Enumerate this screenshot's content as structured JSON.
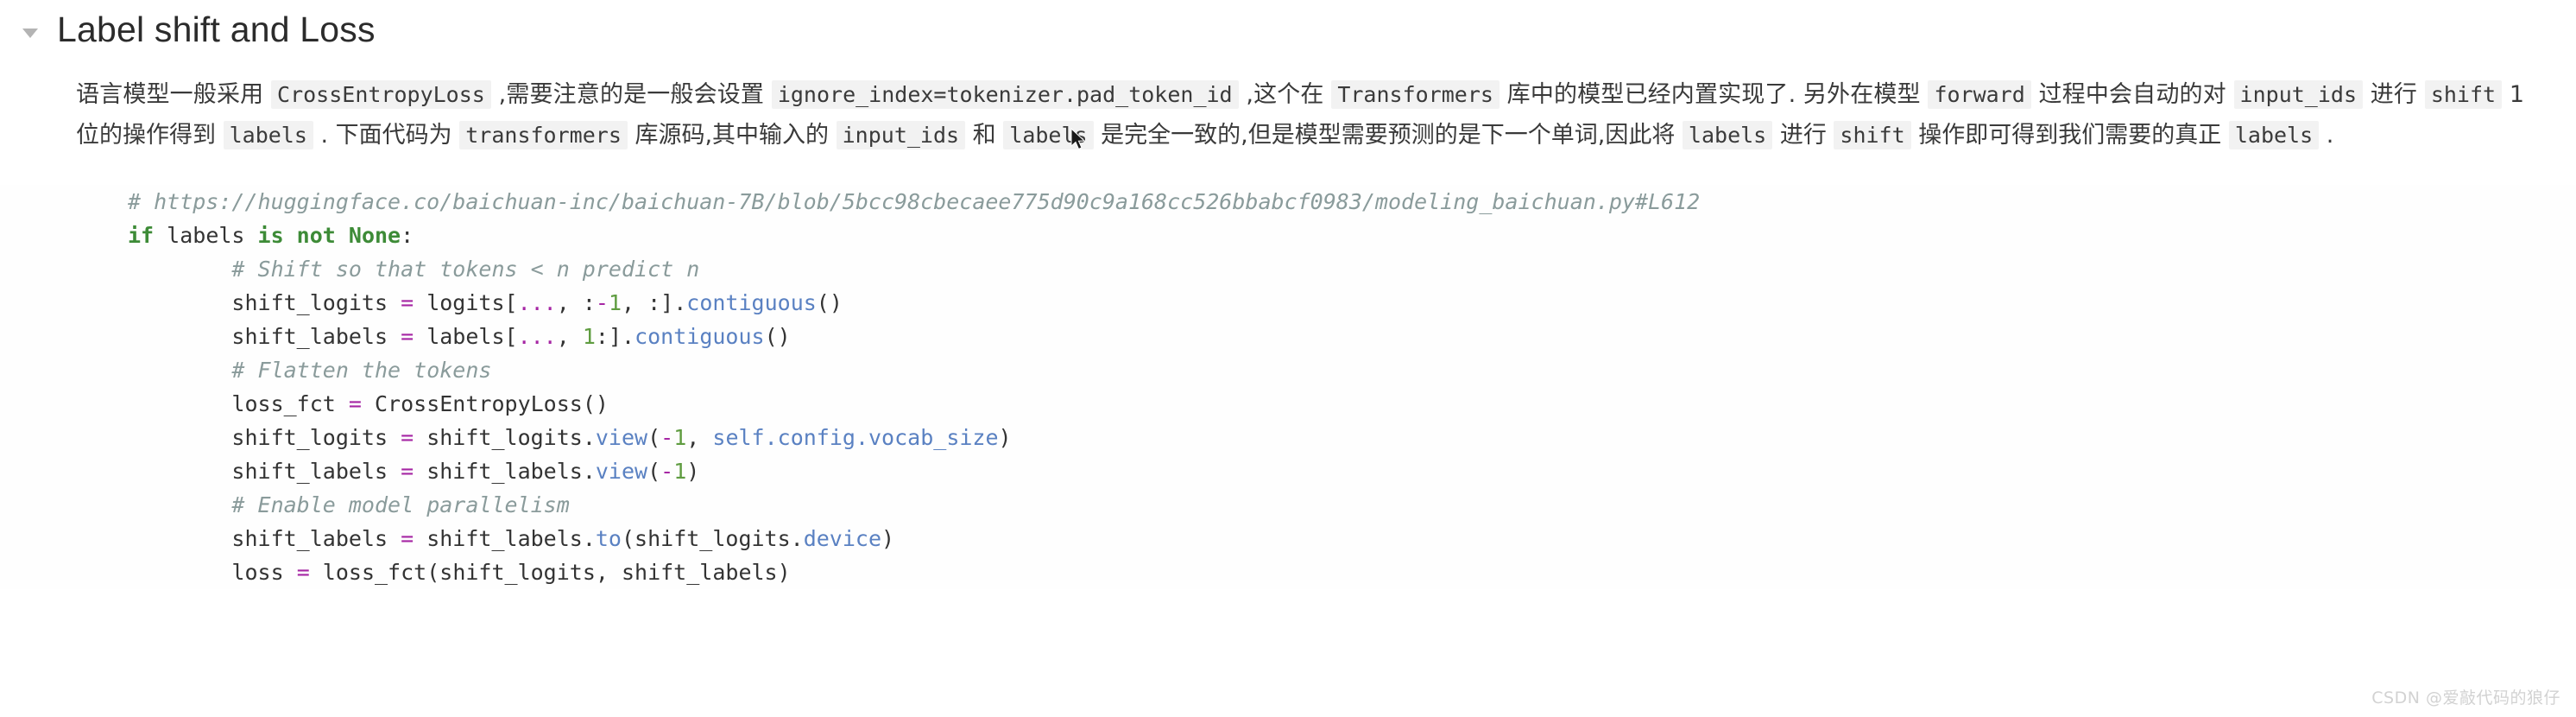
{
  "heading": {
    "toggle_icon": "chevron-down-triangle-icon",
    "title": "Label shift and Loss"
  },
  "paragraph": {
    "seg1": "语言模型一般采用 ",
    "code1": "CrossEntropyLoss",
    "seg2": " ,需要注意的是一般会设置 ",
    "code2": "ignore_index=tokenizer.pad_token_id",
    "seg3": " ,这个在 ",
    "code3": "Transformers",
    "seg4": " 库中的模型已经内置实现了. 另外在模型 ",
    "code4": "forward",
    "seg5": " 过程中会自动的对 ",
    "code5": "input_ids",
    "seg6": " 进行 ",
    "code6": "shift",
    "seg7": " 1位的操作得到 ",
    "code7": "labels",
    "seg8": " . 下面代码为 ",
    "code8": "transformers",
    "seg9": " 库源码,其中输入的 ",
    "code9": "input_ids",
    "seg10": " 和 ",
    "code10": "labels",
    "seg11": " 是完全一致的,但是模型需要预测的是下一个单词,因此将 ",
    "code11": "labels",
    "seg12": " 进行 ",
    "code12": "shift",
    "seg13": " 操作即可得到我们需要的真正 ",
    "code13": "labels",
    "seg14": " ."
  },
  "code_block": {
    "language": "python",
    "lines": [
      {
        "indent": 0,
        "tokens": [
          {
            "t": "comment",
            "v": "# https://huggingface.co/baichuan-inc/baichuan-7B/blob/5bcc98cbecaee775d90c9a168cc526bbabcf0983/modeling_baichuan.py#L612"
          }
        ]
      },
      {
        "indent": 0,
        "tokens": [
          {
            "t": "kw",
            "v": "if"
          },
          {
            "t": "plain",
            "v": " labels "
          },
          {
            "t": "kw",
            "v": "is not None"
          },
          {
            "t": "plain",
            "v": ":"
          }
        ]
      },
      {
        "indent": 1,
        "tokens": [
          {
            "t": "comment",
            "v": "# Shift so that tokens < n predict n"
          }
        ]
      },
      {
        "indent": 1,
        "tokens": [
          {
            "t": "plain",
            "v": "shift_logits "
          },
          {
            "t": "op",
            "v": "="
          },
          {
            "t": "plain",
            "v": " logits["
          },
          {
            "t": "op",
            "v": "..."
          },
          {
            "t": "plain",
            "v": ", :"
          },
          {
            "t": "op",
            "v": "-"
          },
          {
            "t": "num",
            "v": "1"
          },
          {
            "t": "plain",
            "v": ", :]."
          },
          {
            "t": "fn",
            "v": "contiguous"
          },
          {
            "t": "plain",
            "v": "()"
          }
        ]
      },
      {
        "indent": 1,
        "tokens": [
          {
            "t": "plain",
            "v": "shift_labels "
          },
          {
            "t": "op",
            "v": "="
          },
          {
            "t": "plain",
            "v": " labels["
          },
          {
            "t": "op",
            "v": "..."
          },
          {
            "t": "plain",
            "v": ", "
          },
          {
            "t": "num",
            "v": "1"
          },
          {
            "t": "plain",
            "v": ":]."
          },
          {
            "t": "fn",
            "v": "contiguous"
          },
          {
            "t": "plain",
            "v": "()"
          }
        ]
      },
      {
        "indent": 1,
        "tokens": [
          {
            "t": "comment",
            "v": "# Flatten the tokens"
          }
        ]
      },
      {
        "indent": 1,
        "tokens": [
          {
            "t": "plain",
            "v": "loss_fct "
          },
          {
            "t": "op",
            "v": "="
          },
          {
            "t": "plain",
            "v": " CrossEntropyLoss()"
          }
        ]
      },
      {
        "indent": 1,
        "tokens": [
          {
            "t": "plain",
            "v": "shift_logits "
          },
          {
            "t": "op",
            "v": "="
          },
          {
            "t": "plain",
            "v": " shift_logits."
          },
          {
            "t": "fn",
            "v": "view"
          },
          {
            "t": "plain",
            "v": "("
          },
          {
            "t": "op",
            "v": "-"
          },
          {
            "t": "num",
            "v": "1"
          },
          {
            "t": "plain",
            "v": ", "
          },
          {
            "t": "fn",
            "v": "self.config.vocab_size"
          },
          {
            "t": "plain",
            "v": ")"
          }
        ]
      },
      {
        "indent": 1,
        "tokens": [
          {
            "t": "plain",
            "v": "shift_labels "
          },
          {
            "t": "op",
            "v": "="
          },
          {
            "t": "plain",
            "v": " shift_labels."
          },
          {
            "t": "fn",
            "v": "view"
          },
          {
            "t": "plain",
            "v": "("
          },
          {
            "t": "op",
            "v": "-"
          },
          {
            "t": "num",
            "v": "1"
          },
          {
            "t": "plain",
            "v": ")"
          }
        ]
      },
      {
        "indent": 1,
        "tokens": [
          {
            "t": "comment",
            "v": "# Enable model parallelism"
          }
        ]
      },
      {
        "indent": 1,
        "tokens": [
          {
            "t": "plain",
            "v": "shift_labels "
          },
          {
            "t": "op",
            "v": "="
          },
          {
            "t": "plain",
            "v": " shift_labels."
          },
          {
            "t": "fn",
            "v": "to"
          },
          {
            "t": "plain",
            "v": "(shift_logits."
          },
          {
            "t": "fn",
            "v": "device"
          },
          {
            "t": "plain",
            "v": ")"
          }
        ]
      },
      {
        "indent": 1,
        "tokens": [
          {
            "t": "plain",
            "v": "loss "
          },
          {
            "t": "op",
            "v": "="
          },
          {
            "t": "plain",
            "v": " loss_fct(shift_logits, shift_labels)"
          }
        ]
      }
    ]
  },
  "watermark": {
    "text": "CSDN @爱敲代码的狼仔"
  },
  "colors": {
    "background": "#ffffff",
    "text": "#3a3a3a",
    "inline_code_bg": "#f2f2f2",
    "comment": "#8a9b9b",
    "keyword": "#3d8b37",
    "operator": "#a626a4",
    "number": "#5f9c40",
    "function": "#5a81c2",
    "watermark": "#d2d2d2",
    "toggle": "#b0b0b0"
  }
}
